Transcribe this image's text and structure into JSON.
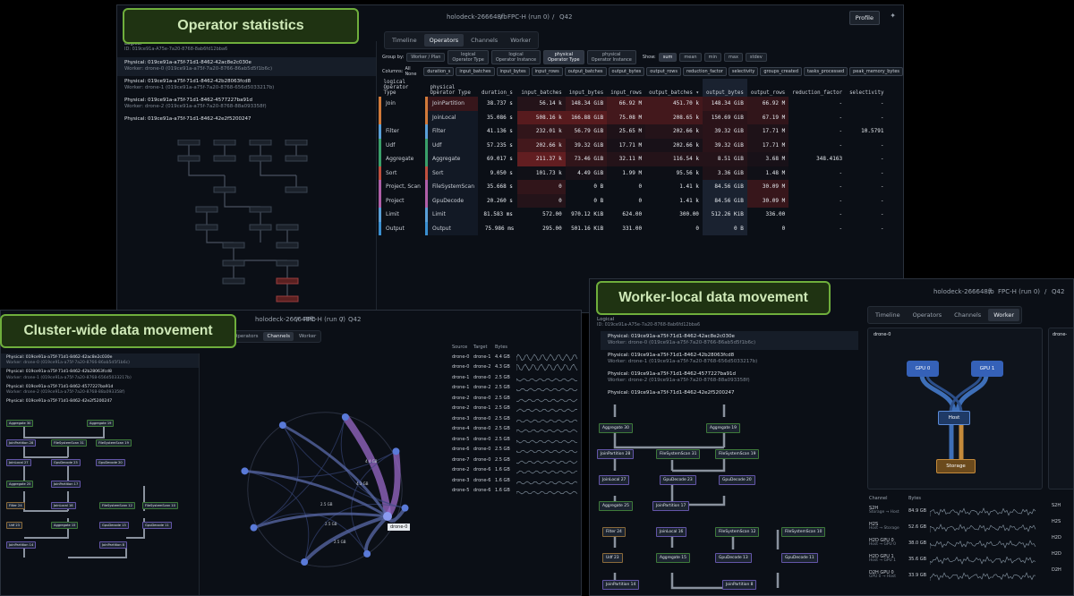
{
  "callouts": {
    "operator_statistics": "Operator statistics",
    "cluster_wide": "Cluster-wide data movement",
    "worker_local": "Worker-local data movement"
  },
  "header": {
    "host": "holodeck-266648fb",
    "run": "FPC-H (run 0)",
    "query": "Q42",
    "profile": "Profile",
    "chevron": "chevron-down-icon"
  },
  "tabs": [
    "Timeline",
    "Operators",
    "Channels",
    "Worker"
  ],
  "logical": {
    "label": "Logical",
    "id": "ID: 019ce91a-A75e-7a20-8768-8ab6fd12bba6"
  },
  "plans": [
    {
      "physical": "Physical: 019ce91a-a75f-71d1-8462-42ac8e2c030e",
      "worker": "Worker: drone-0 (019ce91a-a75f-7a20-8766-86ab5d5f1b6c)"
    },
    {
      "physical": "Physical: 019ce91a-a75f-71d1-8462-42b28063fcd8",
      "worker": "Worker: drone-1 (019ce91a-a75f-7a20-8768-656d5033217b)"
    },
    {
      "physical": "Physical: 019ce91a-a75f-71d1-8462-4577227ba91d",
      "worker": "Worker: drone-2 (019ce91a-a75f-7a20-8768-88a093358f)"
    },
    {
      "physical": "Physical: 019ce91a-a75f-71d1-8462-42e2f5200247",
      "worker": ""
    }
  ],
  "groupby": {
    "label": "Group by:",
    "options": [
      [
        "Worker / Plan",
        ""
      ],
      [
        "logical",
        "Operator Type"
      ],
      [
        "logical",
        "Operator Instance"
      ],
      [
        "physical",
        "Operator Type"
      ],
      [
        "physical",
        "Operator Instance"
      ]
    ],
    "show_label": "Show:",
    "show": [
      "sum",
      "mean",
      "min",
      "max",
      "stdev"
    ]
  },
  "columns": {
    "label": "Columns:",
    "all_none": "All None",
    "items": [
      "duration_s",
      "input_batches",
      "input_bytes",
      "input_rows",
      "output_batches",
      "output_bytes",
      "output_rows",
      "reduction_factor",
      "selectivity",
      "groups_created",
      "tasks_processed",
      "peak_memory_bytes"
    ]
  },
  "table": {
    "headers": [
      [
        "logical",
        "Operator Type"
      ],
      [
        "physical",
        "Operator Type"
      ],
      [
        "",
        "duration_s"
      ],
      [
        "",
        "input_batches"
      ],
      [
        "",
        "input_bytes"
      ],
      [
        "",
        "input_rows"
      ],
      [
        "",
        "output_batches ▾"
      ],
      [
        "",
        "output_bytes"
      ],
      [
        "",
        "output_rows"
      ],
      [
        "",
        "reduction_factor"
      ],
      [
        "",
        "selectivity"
      ]
    ],
    "rows": [
      [
        "Join",
        "JoinPartition",
        "38.737 s",
        "56.14 k",
        "148.34 GiB",
        "66.92 M",
        "451.70 k",
        "148.34 GiB",
        "66.92 M",
        "-",
        "-"
      ],
      [
        "",
        "JoinLocal",
        "35.086 s",
        "508.16 k",
        "166.88 GiB",
        "75.08 M",
        "208.65 k",
        "150.69 GiB",
        "67.19 M",
        "-",
        "-"
      ],
      [
        "Filter",
        "Filter",
        "41.136 s",
        "232.01 k",
        "56.79 GiB",
        "25.65 M",
        "202.66 k",
        "39.32 GiB",
        "17.71 M",
        "-",
        "10.5791"
      ],
      [
        "Udf",
        "Udf",
        "57.235 s",
        "202.66 k",
        "39.32 GiB",
        "17.71 M",
        "202.66 k",
        "39.32 GiB",
        "17.71 M",
        "-",
        "-"
      ],
      [
        "Aggregate",
        "Aggregate",
        "69.017 s",
        "211.37 k",
        "73.46 GiB",
        "32.11 M",
        "116.54 k",
        "8.51 GiB",
        "3.68 M",
        "348.4163",
        "-"
      ],
      [
        "Sort",
        "Sort",
        "9.050 s",
        "101.73 k",
        "4.49 GiB",
        "1.99 M",
        "95.56 k",
        "3.36 GiB",
        "1.48 M",
        "-",
        "-"
      ],
      [
        "Project, Scan",
        "FileSystemScan",
        "35.668 s",
        "0",
        "0 B",
        "0",
        "1.41 k",
        "84.56 GiB",
        "30.09 M",
        "-",
        "-"
      ],
      [
        "Project",
        "GpuDecode",
        "20.260 s",
        "0",
        "0 B",
        "0",
        "1.41 k",
        "84.56 GiB",
        "30.09 M",
        "-",
        "-"
      ],
      [
        "Limit",
        "Limit",
        "81.583 ms",
        "572.00",
        "970.12 KiB",
        "624.00",
        "300.00",
        "512.26 KiB",
        "336.00",
        "-",
        "-"
      ],
      [
        "Output",
        "Output",
        "75.986 ms",
        "295.00",
        "501.16 KiB",
        "331.00",
        "0",
        "0 B",
        "0",
        "-",
        "-"
      ]
    ],
    "row_colors": [
      "#d17a3a",
      "#d17a3a",
      "#5aa0d8",
      "#3aa06a",
      "#3aa06a",
      "#c0503f",
      "#b05fa8",
      "#b05fa8",
      "#5aa0d8",
      "#3a8fd0"
    ],
    "heat": [
      [
        0,
        0.35,
        0,
        0.2,
        0.35,
        0.45,
        0.45,
        0.35,
        0.3,
        0,
        0
      ],
      [
        0,
        0,
        0,
        0.6,
        0.6,
        0.45,
        0.45,
        0.25,
        0.3,
        0,
        0
      ],
      [
        0,
        0,
        0,
        0.3,
        0.3,
        0.15,
        0.2,
        0.25,
        0.15,
        0,
        0
      ],
      [
        0,
        0,
        0,
        0.45,
        0.25,
        0.1,
        0.1,
        0.25,
        0.15,
        0,
        0
      ],
      [
        0,
        0,
        0,
        0.7,
        0.3,
        0.2,
        0.2,
        0.2,
        0.1,
        0,
        0
      ],
      [
        0,
        0,
        0,
        0.05,
        0.1,
        0.02,
        0.02,
        0.15,
        0.05,
        0,
        0
      ],
      [
        0,
        0,
        0,
        0.3,
        0,
        0,
        0,
        0,
        0.35,
        0,
        0
      ],
      [
        0,
        0,
        0,
        0.2,
        0,
        0,
        0,
        0,
        0.35,
        0,
        0
      ],
      [
        0,
        0,
        0,
        0,
        0,
        0,
        0,
        0,
        0,
        0,
        0
      ],
      [
        0,
        0,
        0,
        0,
        0,
        0,
        0,
        0,
        0,
        0,
        0
      ]
    ]
  },
  "cluster": {
    "channel_headers": [
      "Source",
      "Target",
      "Bytes"
    ],
    "channels": [
      [
        "drone-0",
        "drone-1",
        "4.4 GB"
      ],
      [
        "drone-0",
        "drone-2",
        "4.3 GB"
      ],
      [
        "drone-1",
        "drone-0",
        "2.5 GB"
      ],
      [
        "drone-1",
        "drone-2",
        "2.5 GB"
      ],
      [
        "drone-2",
        "drone-0",
        "2.5 GB"
      ],
      [
        "drone-2",
        "drone-1",
        "2.5 GB"
      ],
      [
        "drone-3",
        "drone-0",
        "2.5 GB"
      ],
      [
        "drone-4",
        "drone-0",
        "2.5 GB"
      ],
      [
        "drone-5",
        "drone-0",
        "2.5 GB"
      ],
      [
        "drone-6",
        "drone-0",
        "2.5 GB"
      ],
      [
        "drone-7",
        "drone-0",
        "2.5 GB"
      ],
      [
        "drone-2",
        "drone-6",
        "1.6 GB"
      ],
      [
        "drone-3",
        "drone-6",
        "1.6 GB"
      ],
      [
        "drone-5",
        "drone-6",
        "1.6 GB"
      ]
    ],
    "graph_tag": "drone-0",
    "edge_labels": [
      "4.4 GB",
      "4.3 GB",
      "2.5 GB",
      "2.5 GB",
      "2.5 GB"
    ]
  },
  "worker": {
    "drone_label": "drone-0",
    "drone_label2": "drone-",
    "gpu0": "GPU 0",
    "gpu1": "GPU 1",
    "host": "Host",
    "storage": "Storage",
    "chan_headers": [
      "Channel",
      "Bytes"
    ],
    "channels": [
      [
        "S2H",
        "Storage → Host",
        "84.9 GB"
      ],
      [
        "H2S",
        "Host → Storage",
        "52.6 GB"
      ],
      [
        "H2D GPU 0",
        "Host → GPU 0",
        "38.0 GB"
      ],
      [
        "H2D GPU 1",
        "Host → GPU 1",
        "35.6 GB"
      ],
      [
        "D2H GPU 0",
        "GPU 0 → Host",
        "33.9 GB"
      ]
    ],
    "side_channels": [
      "S2H",
      "H2S",
      "H2D",
      "H2D",
      "D2H"
    ]
  },
  "dag_nodes": [
    [
      "Aggregate 30",
      "gr"
    ],
    [
      "Aggregate 19",
      "gr"
    ],
    [
      "JoinPartition 28",
      "pu"
    ],
    [
      "FileSystemScan 31",
      "gr"
    ],
    [
      "FileSystemScan 19",
      "gr"
    ],
    [
      "JoinLocal 27",
      "pu"
    ],
    [
      "GpuDecode 23",
      "pu"
    ],
    [
      "GpuDecode 20",
      "pu"
    ],
    [
      "Aggregate 25",
      "gr"
    ],
    [
      "JoinPartition 17",
      "pu"
    ],
    [
      "Filter 24",
      "br"
    ],
    [
      "JoinLocal 16",
      "pu"
    ],
    [
      "FileSystemScan 12",
      "gr"
    ],
    [
      "FileSystemScan 10",
      "gr"
    ],
    [
      "Udf 23",
      "br"
    ],
    [
      "Aggregate 15",
      "gr"
    ],
    [
      "GpuDecode 13",
      "pu"
    ],
    [
      "GpuDecode 11",
      "pu"
    ],
    [
      "JoinPartition 14",
      "pu"
    ],
    [
      "JoinPartition 8",
      "pu"
    ]
  ]
}
